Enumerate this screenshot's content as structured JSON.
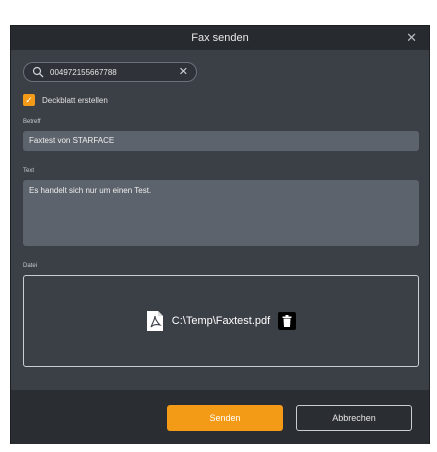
{
  "dialog": {
    "title": "Fax senden",
    "close_icon": "close-icon"
  },
  "search": {
    "value": "004972155667788",
    "icon": "search-icon",
    "clear_icon": "clear-icon"
  },
  "cover_page": {
    "checked": true,
    "label": "Deckblatt erstellen"
  },
  "subject": {
    "label": "Betreff",
    "value": "Faxtest von STARFACE"
  },
  "text": {
    "label": "Text",
    "value": "Es handelt sich nur um einen Test."
  },
  "file": {
    "label": "Datei",
    "name": "C:\\Temp\\Faxtest.pdf",
    "icon": "pdf-file-icon",
    "delete_icon": "trash-icon"
  },
  "buttons": {
    "send": "Senden",
    "cancel": "Abbrechen"
  },
  "colors": {
    "accent": "#f39a16",
    "dialog_bg": "#3b3f46",
    "title_bg": "#272a2f",
    "footer_bg": "#2a2d32",
    "field_bg": "#5d636c"
  }
}
